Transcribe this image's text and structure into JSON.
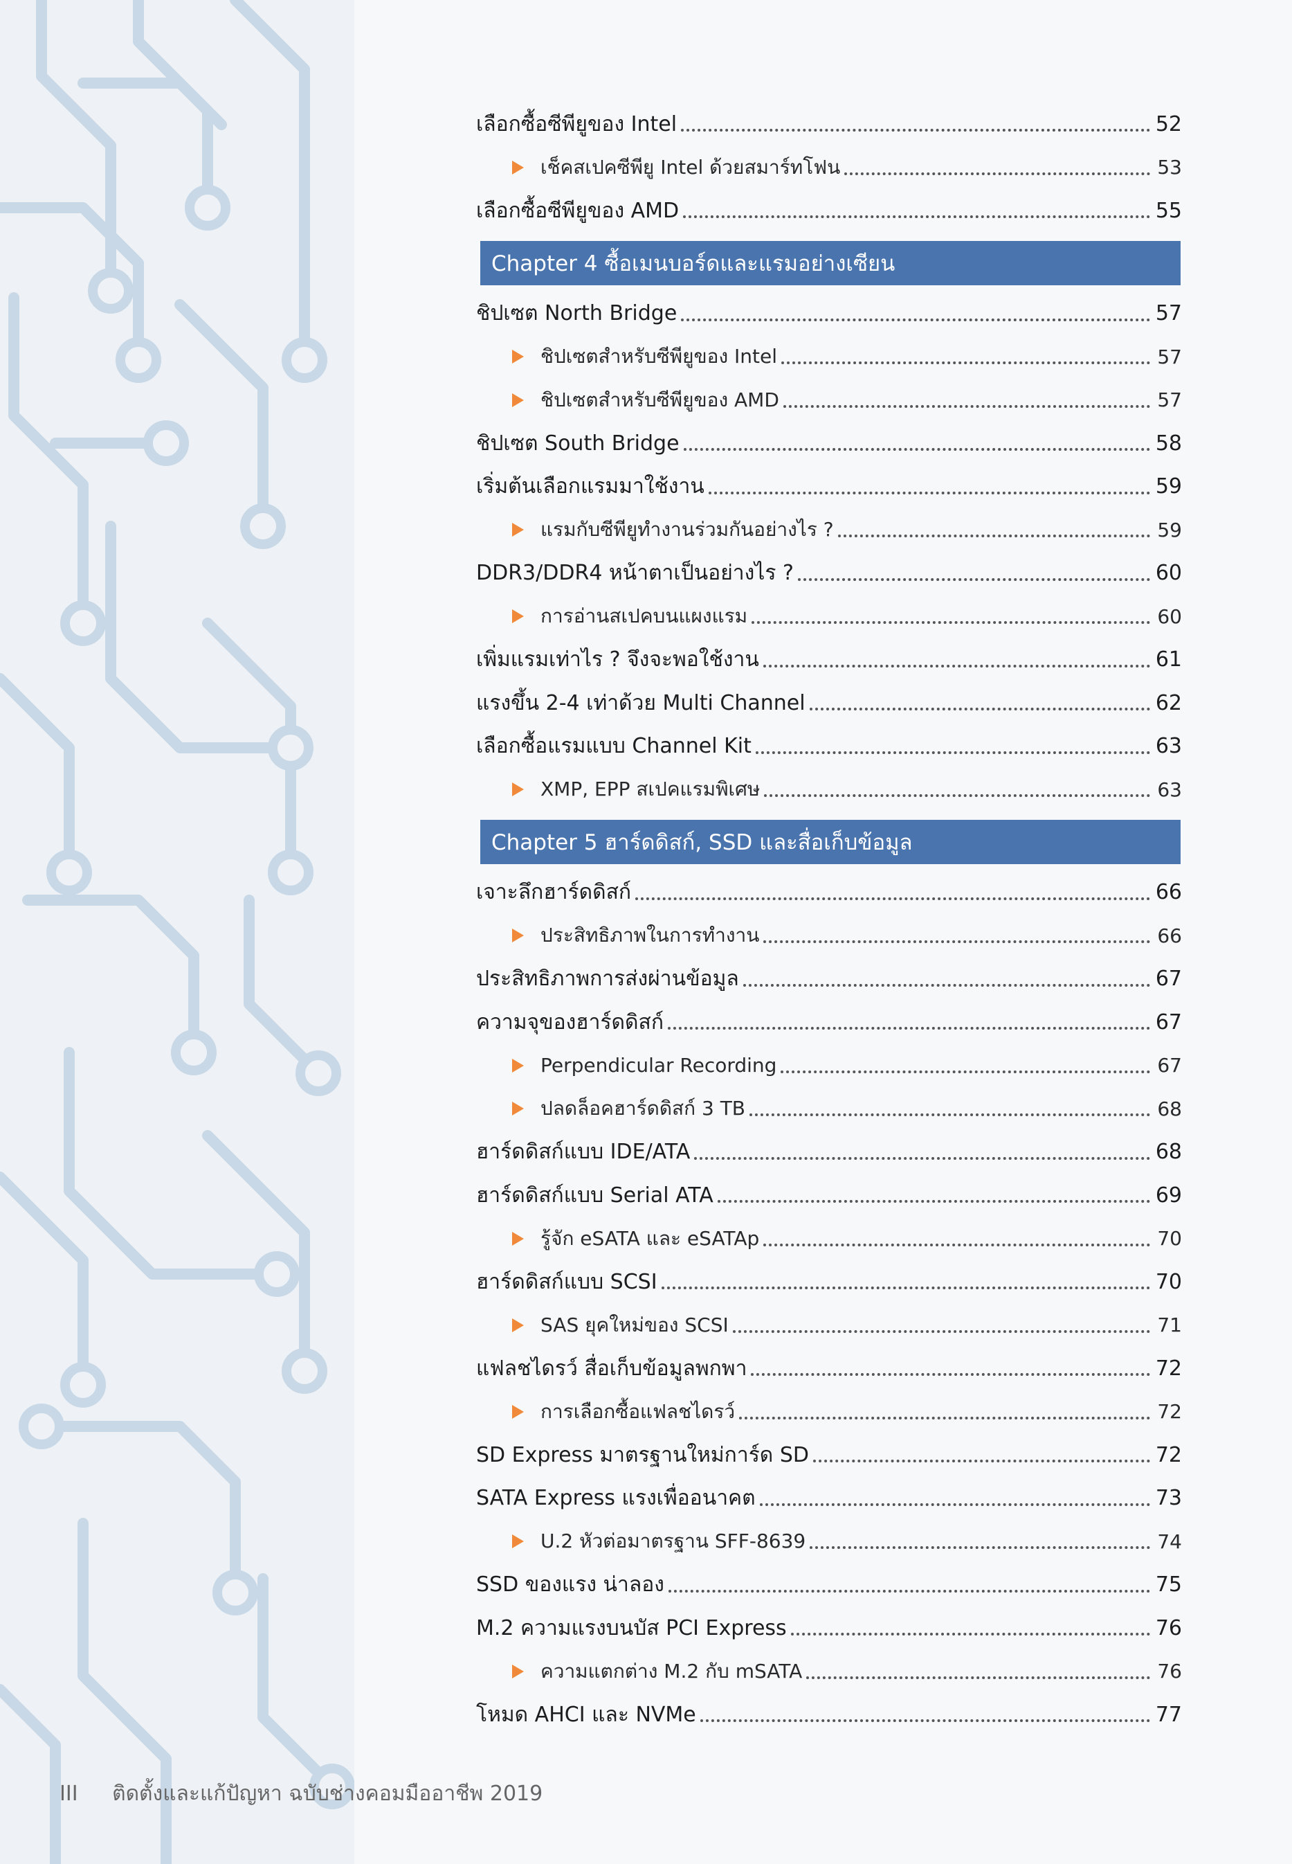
{
  "colors": {
    "chapter_bar": "#4a74ad",
    "arrow": "#f08a3a",
    "circuit_line": "#c9d8e6"
  },
  "toc": [
    {
      "type": "entry",
      "level": 0,
      "text": "เลือกซื้อซีพียูของ Intel",
      "page": "52"
    },
    {
      "type": "entry",
      "level": 1,
      "text": "เช็คสเปคซีพียู Intel ด้วยสมาร์ทโฟน",
      "page": "53"
    },
    {
      "type": "entry",
      "level": 0,
      "text": "เลือกซื้อซีพียูของ AMD",
      "page": "55"
    },
    {
      "type": "chapter",
      "text": "Chapter 4 ซื้อเมนบอร์ดและแรมอย่างเซียน"
    },
    {
      "type": "entry",
      "level": 0,
      "text": "ชิปเซต North Bridge",
      "page": "57"
    },
    {
      "type": "entry",
      "level": 1,
      "text": "ชิปเซตสำหรับซีพียูของ Intel",
      "page": "57"
    },
    {
      "type": "entry",
      "level": 1,
      "text": "ชิปเซตสำหรับซีพียูของ AMD",
      "page": "57"
    },
    {
      "type": "entry",
      "level": 0,
      "text": "ชิปเซต South Bridge",
      "page": "58"
    },
    {
      "type": "entry",
      "level": 0,
      "text": "เริ่มต้นเลือกแรมมาใช้งาน",
      "page": "59"
    },
    {
      "type": "entry",
      "level": 1,
      "text": "แรมกับซีพียูทำงานร่วมกันอย่างไร ?",
      "page": "59"
    },
    {
      "type": "entry",
      "level": 0,
      "text": "DDR3/DDR4 หน้าตาเป็นอย่างไร ?",
      "page": "60"
    },
    {
      "type": "entry",
      "level": 1,
      "text": "การอ่านสเปคบนแผงแรม",
      "page": "60"
    },
    {
      "type": "entry",
      "level": 0,
      "text": "เพิ่มแรมเท่าไร ? จึงจะพอใช้งาน",
      "page": "61"
    },
    {
      "type": "entry",
      "level": 0,
      "text": "แรงขึ้น 2-4 เท่าด้วย Multi Channel",
      "page": "62"
    },
    {
      "type": "entry",
      "level": 0,
      "text": "เลือกซื้อแรมแบบ Channel Kit",
      "page": "63"
    },
    {
      "type": "entry",
      "level": 1,
      "text": "XMP, EPP สเปคแรมพิเศษ",
      "page": "63"
    },
    {
      "type": "chapter",
      "text": "Chapter 5 ฮาร์ดดิสก์, SSD และสื่อเก็บข้อมูล"
    },
    {
      "type": "entry",
      "level": 0,
      "text": "เจาะลึกฮาร์ดดิสก์",
      "page": "66"
    },
    {
      "type": "entry",
      "level": 1,
      "text": "ประสิทธิภาพในการทำงาน",
      "page": "66"
    },
    {
      "type": "entry",
      "level": 0,
      "text": "ประสิทธิภาพการส่งผ่านข้อมูล",
      "page": "67"
    },
    {
      "type": "entry",
      "level": 0,
      "text": "ความจุของฮาร์ดดิสก์",
      "page": "67"
    },
    {
      "type": "entry",
      "level": 1,
      "text": "Perpendicular Recording",
      "page": "67"
    },
    {
      "type": "entry",
      "level": 1,
      "text": "ปลดล็อคฮาร์ดดิสก์ 3 TB",
      "page": "68"
    },
    {
      "type": "entry",
      "level": 0,
      "text": "ฮาร์ดดิสก์แบบ IDE/ATA",
      "page": "68"
    },
    {
      "type": "entry",
      "level": 0,
      "text": "ฮาร์ดดิสก์แบบ Serial ATA",
      "page": "69"
    },
    {
      "type": "entry",
      "level": 1,
      "text": "รู้จัก eSATA และ eSATAp",
      "page": "70"
    },
    {
      "type": "entry",
      "level": 0,
      "text": "ฮาร์ดดิสก์แบบ SCSI",
      "page": "70"
    },
    {
      "type": "entry",
      "level": 1,
      "text": "SAS ยุคใหม่ของ SCSI",
      "page": "71"
    },
    {
      "type": "entry",
      "level": 0,
      "text": "แฟลชไดรว์ สื่อเก็บข้อมูลพกพา",
      "page": "72"
    },
    {
      "type": "entry",
      "level": 1,
      "text": "การเลือกซื้อแฟลชไดรว์",
      "page": "72"
    },
    {
      "type": "entry",
      "level": 0,
      "text": "SD Express มาตรฐานใหม่การ์ด SD",
      "page": "72"
    },
    {
      "type": "entry",
      "level": 0,
      "text": "SATA Express แรงเพื่ออนาคต",
      "page": "73"
    },
    {
      "type": "entry",
      "level": 1,
      "text": "U.2 หัวต่อมาตรฐาน SFF-8639",
      "page": "74"
    },
    {
      "type": "entry",
      "level": 0,
      "text": "SSD ของแรง น่าลอง",
      "page": "75"
    },
    {
      "type": "entry",
      "level": 0,
      "text": "M.2 ความแรงบนบัส PCI Express",
      "page": "76"
    },
    {
      "type": "entry",
      "level": 1,
      "text": "ความแตกต่าง M.2 กับ mSATA",
      "page": "76"
    },
    {
      "type": "entry",
      "level": 0,
      "text": "โหมด AHCI และ NVMe",
      "page": "77"
    }
  ],
  "footer": {
    "page_number": "III",
    "book_title": "ติดตั้งและแก้ปัญหา ฉบับช่างคอมมืออาชีพ 2019"
  }
}
